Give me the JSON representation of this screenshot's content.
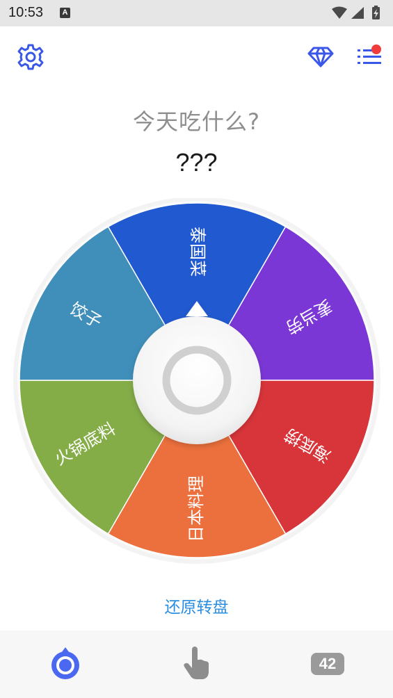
{
  "status_bar": {
    "time": "10:53",
    "notification_icon_letter": "A",
    "icons": [
      "wifi-icon",
      "signal-icon",
      "battery-charging-icon"
    ]
  },
  "toolbar": {
    "settings_icon": "gear-icon",
    "premium_icon": "diamond-icon",
    "list_icon": "list-icon",
    "list_has_notification": true,
    "accent_color": "#3b57e8",
    "notification_dot_color": "#f03c3c"
  },
  "main": {
    "title": "今天吃什么?",
    "result": "???"
  },
  "wheel": {
    "segments": [
      {
        "label": "泰国菜",
        "color": "#2159d0"
      },
      {
        "label": "麦当劳",
        "color": "#7b37d5"
      },
      {
        "label": "海底捞",
        "color": "#d8353a"
      },
      {
        "label": "日本料理",
        "color": "#ec703d"
      },
      {
        "label": "火锅底料",
        "color": "#84ad48"
      },
      {
        "label": "饺子",
        "color": "#3f8fba"
      }
    ],
    "spin_button_icon": "ring-icon"
  },
  "actions": {
    "reset_label": "还原转盘"
  },
  "bottom_nav": {
    "items": [
      {
        "icon": "wheel-icon",
        "active": true
      },
      {
        "icon": "tap-hand-icon",
        "active": false
      },
      {
        "icon": "count-badge",
        "label": "42",
        "active": false
      }
    ]
  }
}
